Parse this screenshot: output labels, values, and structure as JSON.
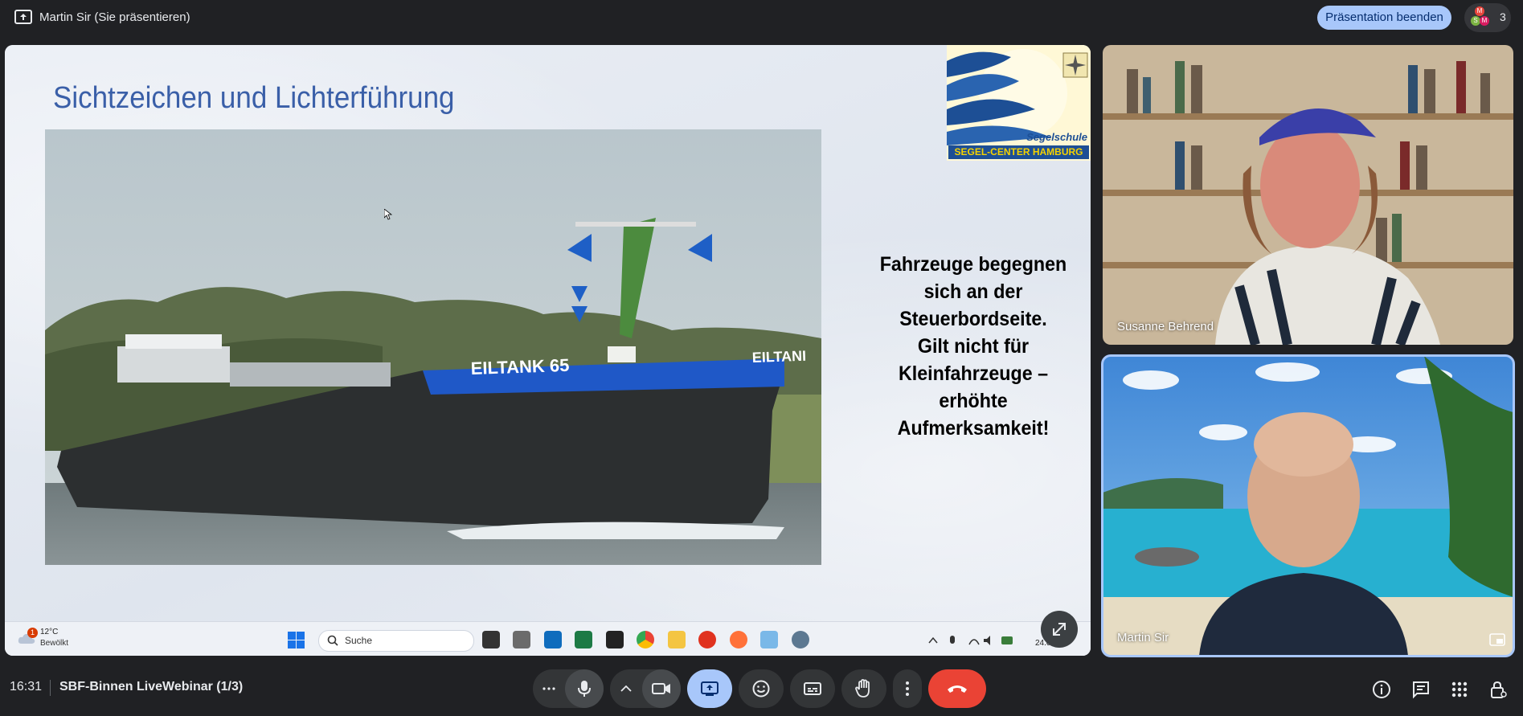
{
  "topbar": {
    "presenter_label": "Martin Sir (Sie präsentieren)",
    "stop_presenting_label": "Präsentation beenden",
    "participant_count": "3",
    "avatars": [
      {
        "letter": "M",
        "color": "#e8453c"
      },
      {
        "letter": "S",
        "color": "#7cb342"
      },
      {
        "letter": "M",
        "color": "#d81b60"
      }
    ]
  },
  "slide": {
    "title": "Sichtzeichen und Lichterführung",
    "photo_caption": "EILTANK 65",
    "photo_caption_partial": "EILTANI",
    "logo_line1": "Segelschule",
    "logo_line2": "SEGEL-CENTER HAMBURG",
    "body_lines": [
      "Fahrzeuge begegnen",
      "sich an der",
      "Steuerbordseite.",
      "Gilt nicht für",
      "Kleinfahrzeuge –",
      "erhöhte",
      "Aufmerksamkeit!"
    ]
  },
  "windows_taskbar": {
    "weather_badge": "1",
    "weather_temp": "12°C",
    "weather_desc": "Bewölkt",
    "search_placeholder": "Suche",
    "date_partial": "24.0",
    "apps": [
      "file-explorer",
      "game",
      "outlook",
      "excel",
      "terminal",
      "chrome",
      "folder",
      "acrobat",
      "firefox",
      "paint",
      "settings"
    ]
  },
  "participants": [
    {
      "name": "Susanne Behrend"
    },
    {
      "name": "Martin Sir"
    }
  ],
  "bottombar": {
    "time": "16:31",
    "meeting_title": "SBF-Binnen LiveWebinar (1/3)"
  },
  "colors": {
    "background": "#202124",
    "accent": "#a8c7fa",
    "end_call": "#ea4335",
    "slide_title": "#3a5fa8"
  }
}
